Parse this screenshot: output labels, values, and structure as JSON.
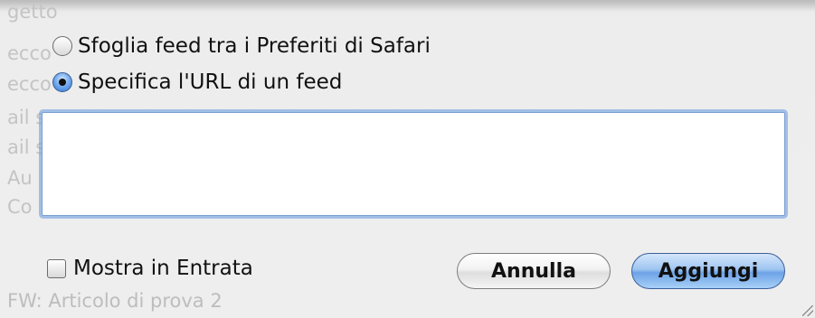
{
  "background_list": {
    "line1": "getto",
    "line2": "ecco",
    "line3": "ecco",
    "line4": "ail s",
    "line5": "ail s",
    "line6": "Au",
    "line7": "Co",
    "subject": "FW: Articolo di prova 2"
  },
  "dialog": {
    "options": [
      {
        "label": "Sfoglia feed tra i Preferiti di Safari",
        "selected": false
      },
      {
        "label": "Specifica l'URL di un feed",
        "selected": true
      }
    ],
    "url_value": "",
    "checkbox_label": "Mostra in Entrata",
    "checkbox_checked": false,
    "cancel_label": "Annulla",
    "add_label": "Aggiungi"
  },
  "colors": {
    "default_button": "#9fc5f1",
    "focus_ring": "#7b9fd0",
    "selected_radio": "#2f73d0"
  }
}
